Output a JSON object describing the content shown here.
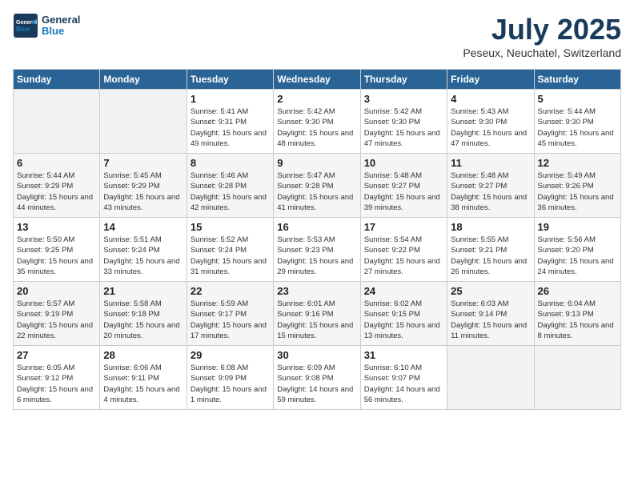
{
  "header": {
    "logo_general": "General",
    "logo_blue": "Blue",
    "title": "July 2025",
    "subtitle": "Peseux, Neuchatel, Switzerland"
  },
  "weekdays": [
    "Sunday",
    "Monday",
    "Tuesday",
    "Wednesday",
    "Thursday",
    "Friday",
    "Saturday"
  ],
  "weeks": [
    [
      {
        "day": "",
        "info": ""
      },
      {
        "day": "",
        "info": ""
      },
      {
        "day": "1",
        "info": "Sunrise: 5:41 AM\nSunset: 9:31 PM\nDaylight: 15 hours and 49 minutes."
      },
      {
        "day": "2",
        "info": "Sunrise: 5:42 AM\nSunset: 9:30 PM\nDaylight: 15 hours and 48 minutes."
      },
      {
        "day": "3",
        "info": "Sunrise: 5:42 AM\nSunset: 9:30 PM\nDaylight: 15 hours and 47 minutes."
      },
      {
        "day": "4",
        "info": "Sunrise: 5:43 AM\nSunset: 9:30 PM\nDaylight: 15 hours and 47 minutes."
      },
      {
        "day": "5",
        "info": "Sunrise: 5:44 AM\nSunset: 9:30 PM\nDaylight: 15 hours and 45 minutes."
      }
    ],
    [
      {
        "day": "6",
        "info": "Sunrise: 5:44 AM\nSunset: 9:29 PM\nDaylight: 15 hours and 44 minutes."
      },
      {
        "day": "7",
        "info": "Sunrise: 5:45 AM\nSunset: 9:29 PM\nDaylight: 15 hours and 43 minutes."
      },
      {
        "day": "8",
        "info": "Sunrise: 5:46 AM\nSunset: 9:28 PM\nDaylight: 15 hours and 42 minutes."
      },
      {
        "day": "9",
        "info": "Sunrise: 5:47 AM\nSunset: 9:28 PM\nDaylight: 15 hours and 41 minutes."
      },
      {
        "day": "10",
        "info": "Sunrise: 5:48 AM\nSunset: 9:27 PM\nDaylight: 15 hours and 39 minutes."
      },
      {
        "day": "11",
        "info": "Sunrise: 5:48 AM\nSunset: 9:27 PM\nDaylight: 15 hours and 38 minutes."
      },
      {
        "day": "12",
        "info": "Sunrise: 5:49 AM\nSunset: 9:26 PM\nDaylight: 15 hours and 36 minutes."
      }
    ],
    [
      {
        "day": "13",
        "info": "Sunrise: 5:50 AM\nSunset: 9:25 PM\nDaylight: 15 hours and 35 minutes."
      },
      {
        "day": "14",
        "info": "Sunrise: 5:51 AM\nSunset: 9:24 PM\nDaylight: 15 hours and 33 minutes."
      },
      {
        "day": "15",
        "info": "Sunrise: 5:52 AM\nSunset: 9:24 PM\nDaylight: 15 hours and 31 minutes."
      },
      {
        "day": "16",
        "info": "Sunrise: 5:53 AM\nSunset: 9:23 PM\nDaylight: 15 hours and 29 minutes."
      },
      {
        "day": "17",
        "info": "Sunrise: 5:54 AM\nSunset: 9:22 PM\nDaylight: 15 hours and 27 minutes."
      },
      {
        "day": "18",
        "info": "Sunrise: 5:55 AM\nSunset: 9:21 PM\nDaylight: 15 hours and 26 minutes."
      },
      {
        "day": "19",
        "info": "Sunrise: 5:56 AM\nSunset: 9:20 PM\nDaylight: 15 hours and 24 minutes."
      }
    ],
    [
      {
        "day": "20",
        "info": "Sunrise: 5:57 AM\nSunset: 9:19 PM\nDaylight: 15 hours and 22 minutes."
      },
      {
        "day": "21",
        "info": "Sunrise: 5:58 AM\nSunset: 9:18 PM\nDaylight: 15 hours and 20 minutes."
      },
      {
        "day": "22",
        "info": "Sunrise: 5:59 AM\nSunset: 9:17 PM\nDaylight: 15 hours and 17 minutes."
      },
      {
        "day": "23",
        "info": "Sunrise: 6:01 AM\nSunset: 9:16 PM\nDaylight: 15 hours and 15 minutes."
      },
      {
        "day": "24",
        "info": "Sunrise: 6:02 AM\nSunset: 9:15 PM\nDaylight: 15 hours and 13 minutes."
      },
      {
        "day": "25",
        "info": "Sunrise: 6:03 AM\nSunset: 9:14 PM\nDaylight: 15 hours and 11 minutes."
      },
      {
        "day": "26",
        "info": "Sunrise: 6:04 AM\nSunset: 9:13 PM\nDaylight: 15 hours and 8 minutes."
      }
    ],
    [
      {
        "day": "27",
        "info": "Sunrise: 6:05 AM\nSunset: 9:12 PM\nDaylight: 15 hours and 6 minutes."
      },
      {
        "day": "28",
        "info": "Sunrise: 6:06 AM\nSunset: 9:11 PM\nDaylight: 15 hours and 4 minutes."
      },
      {
        "day": "29",
        "info": "Sunrise: 6:08 AM\nSunset: 9:09 PM\nDaylight: 15 hours and 1 minute."
      },
      {
        "day": "30",
        "info": "Sunrise: 6:09 AM\nSunset: 9:08 PM\nDaylight: 14 hours and 59 minutes."
      },
      {
        "day": "31",
        "info": "Sunrise: 6:10 AM\nSunset: 9:07 PM\nDaylight: 14 hours and 56 minutes."
      },
      {
        "day": "",
        "info": ""
      },
      {
        "day": "",
        "info": ""
      }
    ]
  ]
}
